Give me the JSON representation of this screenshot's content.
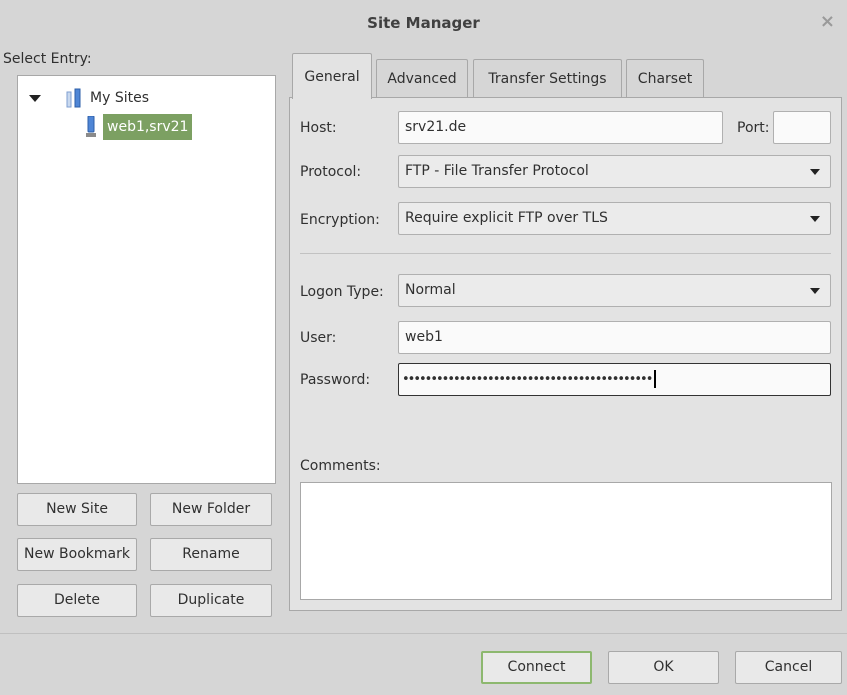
{
  "window": {
    "title": "Site Manager",
    "close_glyph": "×",
    "accent_color": "#7ca062"
  },
  "sidebar": {
    "select_label": "Select Entry:",
    "tree": {
      "root_label": "My Sites",
      "root_icon": "folder-icon",
      "child_label": "web1,srv21",
      "child_icon": "server-icon"
    },
    "buttons": {
      "new_site": "New Site",
      "new_folder": "New Folder",
      "new_bookmark": "New Bookmark",
      "rename": "Rename",
      "delete": "Delete",
      "duplicate": "Duplicate"
    }
  },
  "tabs": [
    {
      "label": "General",
      "active": true
    },
    {
      "label": "Advanced",
      "active": false
    },
    {
      "label": "Transfer Settings",
      "active": false
    },
    {
      "label": "Charset",
      "active": false
    }
  ],
  "general": {
    "host_label": "Host:",
    "host_value": "srv21.de",
    "port_label": "Port:",
    "port_value": "",
    "protocol_label": "Protocol:",
    "protocol_value": "FTP - File Transfer Protocol",
    "encryption_label": "Encryption:",
    "encryption_value": "Require explicit FTP over TLS",
    "logon_type_label": "Logon Type:",
    "logon_type_value": "Normal",
    "user_label": "User:",
    "user_value": "web1",
    "password_label": "Password:",
    "password_mask": "••••••••••••••••••••••••••••••••••••••••••••",
    "comments_label": "Comments:",
    "comments_value": ""
  },
  "footer": {
    "connect": "Connect",
    "ok": "OK",
    "cancel": "Cancel"
  }
}
